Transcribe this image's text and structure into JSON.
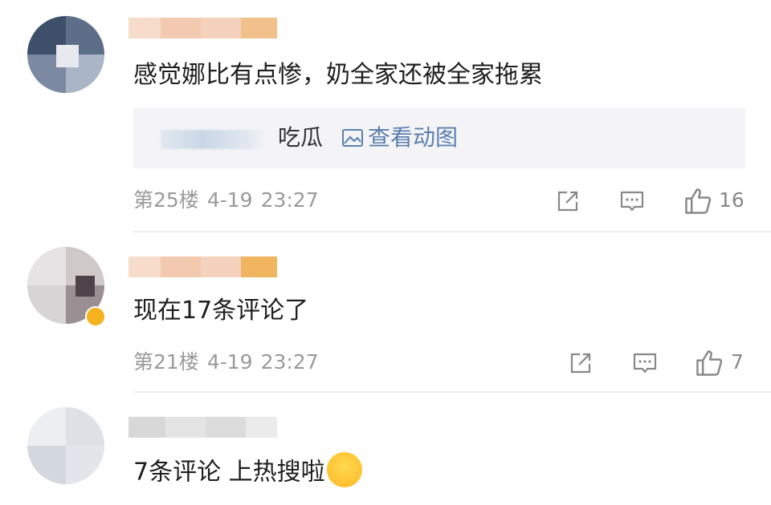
{
  "comments": [
    {
      "text": "感觉娜比有点惨，奶全家还被全家拖累",
      "quote": {
        "text": "吃瓜",
        "link_label": "查看动图",
        "link_icon": "image-icon"
      },
      "floor": "第25楼",
      "date": "4-19",
      "time": "23:27",
      "likes": "16"
    },
    {
      "text": "现在17条评论了",
      "floor": "第21楼",
      "date": "4-19",
      "time": "23:27",
      "likes": "7"
    },
    {
      "text": "7条评论 上热搜啦",
      "emoji": "hugging-face-emoji"
    }
  ],
  "icons": {
    "share": "share-icon",
    "reply": "comment-icon",
    "like": "thumbs-up-icon"
  },
  "colors": {
    "link": "#5b7fae",
    "meta": "#9a9a9a",
    "quote_bg": "#f4f4f6"
  }
}
